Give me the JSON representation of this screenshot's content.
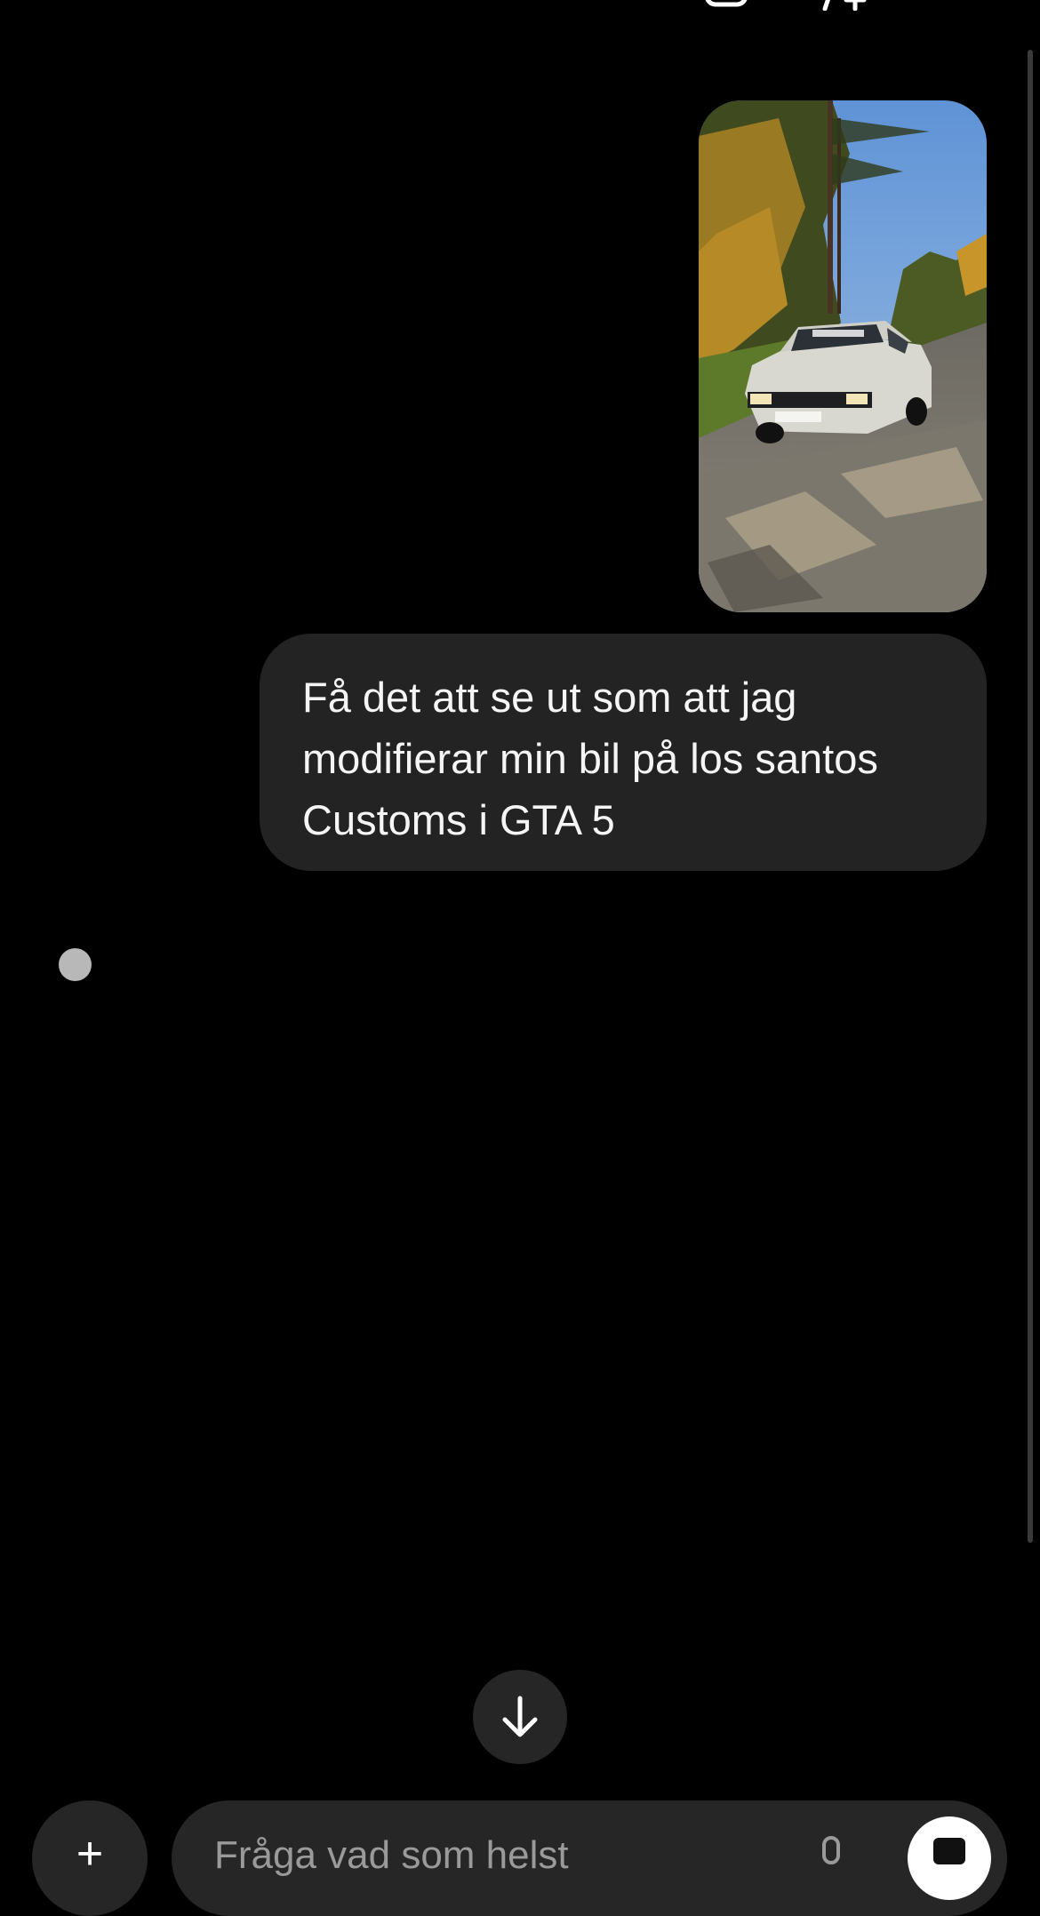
{
  "status_bar": {
    "left_text": "",
    "icon_1": "camera-icon",
    "icon_2": "person-add-icon"
  },
  "conversation": {
    "image_message": {
      "description_icon": "car-photo-icon"
    },
    "user_message": "Få det att se ut som att jag modifierar min bil på los santos Customs i GTA 5",
    "thinking_indicator": "thinking-dot"
  },
  "controls": {
    "scroll_down_icon": "arrow-down-icon",
    "plus_icon": "plus-icon",
    "composer_placeholder": "Fråga vad som helst",
    "mic_icon": "mic-icon",
    "voice_icon": "voice-mode-icon"
  },
  "colors": {
    "background": "#000000",
    "bubble": "#232323",
    "button": "#262626",
    "text": "#f5f5f5",
    "dot": "#b8b8b8"
  }
}
